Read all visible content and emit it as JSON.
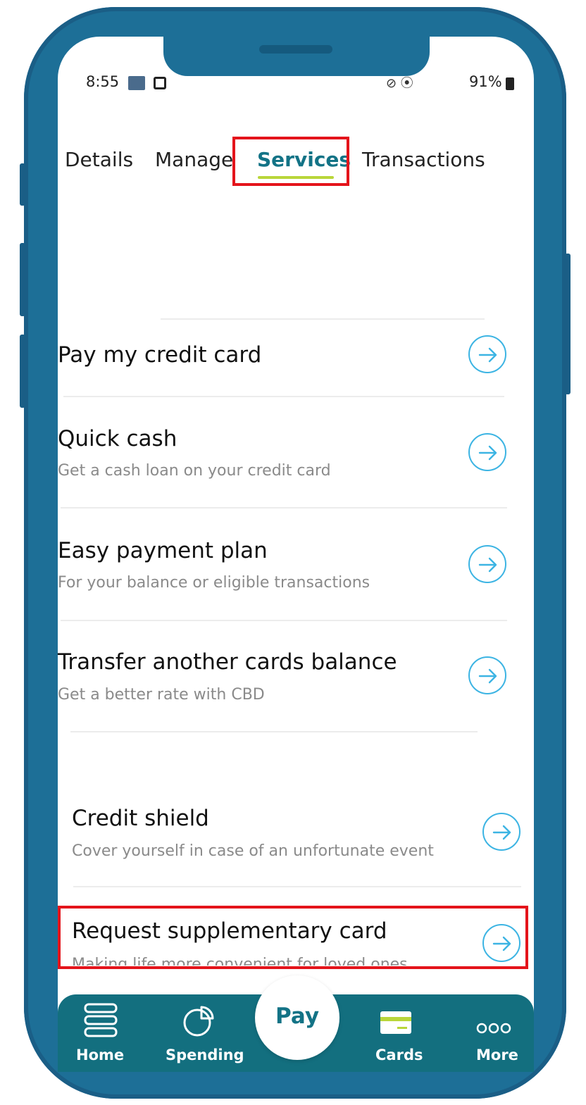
{
  "status_bar": {
    "time": "8:55",
    "right_icons": "⊘ ⦿",
    "battery": "91%"
  },
  "tabs": [
    {
      "label": "Details",
      "active": false
    },
    {
      "label": "Manage",
      "active": false
    },
    {
      "label": "Services",
      "active": true
    },
    {
      "label": "Transactions",
      "active": false
    }
  ],
  "services": [
    {
      "title": "Pay my credit card",
      "subtitle": ""
    },
    {
      "title": "Quick cash",
      "subtitle": "Get a cash loan on your credit card"
    },
    {
      "title": "Easy payment plan",
      "subtitle": "For your balance or eligible transactions"
    },
    {
      "title": "Transfer another cards balance",
      "subtitle": "Get a better rate with CBD"
    },
    {
      "title": "Credit shield",
      "subtitle": "Cover yourself in case of an unfortunate event"
    },
    {
      "title": "Request supplementary card",
      "subtitle": "Making life more convenient for loved ones"
    }
  ],
  "bottom_nav": {
    "home": "Home",
    "spending": "Spending",
    "pay": "Pay",
    "cards": "Cards",
    "more": "More"
  },
  "colors": {
    "frame": "#1d6f97",
    "accent": "#137386",
    "tab_underline": "#b9d63a",
    "highlight": "#e4141b",
    "arrow": "#3cb4e3"
  }
}
